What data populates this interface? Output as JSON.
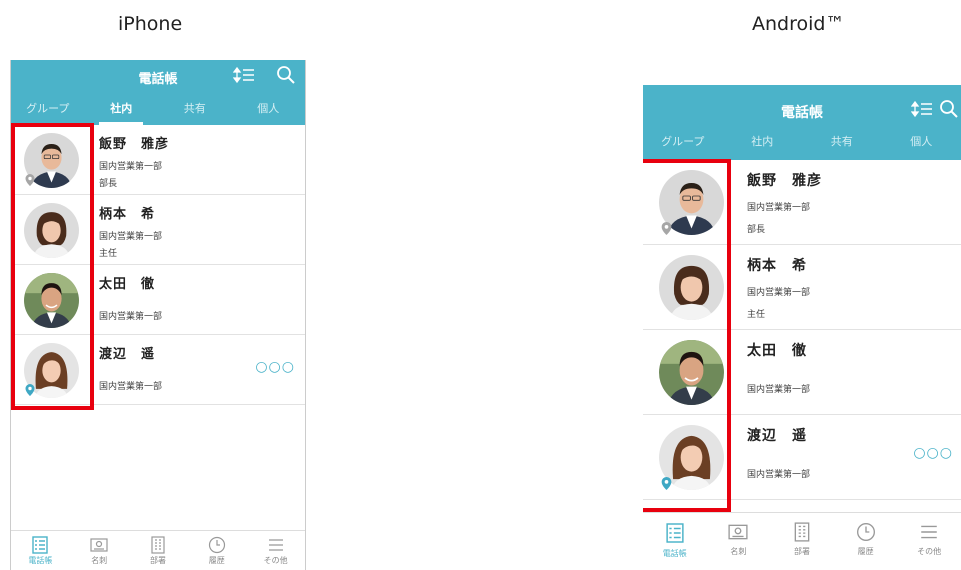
{
  "labels": {
    "ios": "iPhone",
    "android": "Android™"
  },
  "app": {
    "title": "電話帳",
    "tabs": [
      "グループ",
      "社内",
      "共有",
      "個人"
    ],
    "active_tab_index": 1,
    "contacts": [
      {
        "name": "飯野　雅彦",
        "department": "国内営業第一部",
        "position": "部長",
        "location_pin": "gray",
        "avatar": "man-with-glasses"
      },
      {
        "name": "柄本　希",
        "department": "国内営業第一部",
        "position": "主任",
        "location_pin": "",
        "avatar": "woman-short-hair"
      },
      {
        "name": "太田　徹",
        "department": "国内営業第一部",
        "position": "",
        "location_pin": "",
        "avatar": "man-smiling"
      },
      {
        "name": "渡辺　遥",
        "department": "国内営業第一部",
        "position": "",
        "location_pin": "blue",
        "avatar": "woman-long-hair",
        "has_more": true
      }
    ],
    "more_glyph": "○○○",
    "nav": [
      {
        "label": "電話帳",
        "icon": "phonebook-icon",
        "active": true
      },
      {
        "label": "名刺",
        "icon": "business-card-icon",
        "active": false
      },
      {
        "label": "部署",
        "icon": "department-building-icon",
        "active": false
      },
      {
        "label": "履歴",
        "icon": "history-clock-icon",
        "active": false
      },
      {
        "label": "その他",
        "icon": "menu-icon",
        "active": false
      }
    ]
  },
  "colors": {
    "accent": "#4bb3c9",
    "highlight": "#e8000e",
    "pin_gray": "#a6a6a6",
    "pin_blue": "#3fa8c4"
  }
}
